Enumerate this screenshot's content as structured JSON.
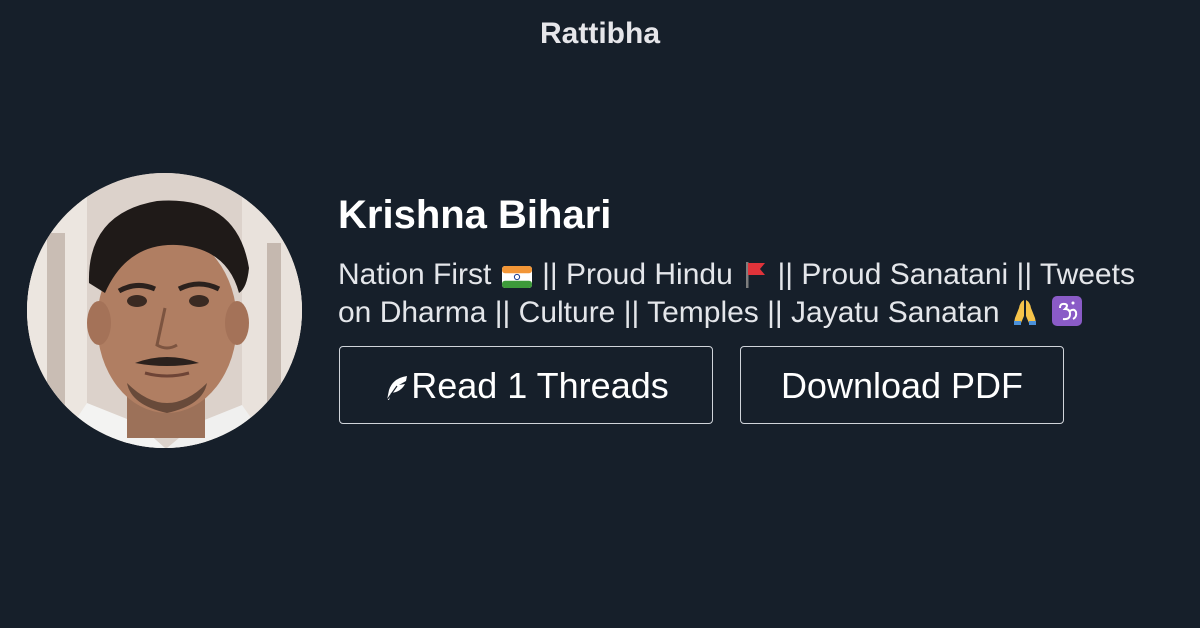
{
  "site": {
    "brand": "Rattibha"
  },
  "profile": {
    "name": "Krishna Bihari",
    "avatar_icon": "profile-photo",
    "bio": {
      "line1": {
        "part1": "Nation First",
        "part2": "|| Proud Hindu",
        "part3": "|| Proud Sanatani || Tweets"
      },
      "line2": {
        "part1": "on Dharma || Culture || Temples || Jayatu Sanatan"
      },
      "emojis": [
        "india-flag-icon",
        "red-flag-icon",
        "folded-hands-icon",
        "om-icon"
      ]
    }
  },
  "actions": {
    "read_label": "Read 1 Threads",
    "read_icon": "feather-icon",
    "pdf_label": "Download PDF"
  },
  "colors": {
    "background": "#161f2a",
    "brand_text": "#e6e6ea",
    "button_border": "#d0d4da",
    "text": "#ffffff"
  }
}
